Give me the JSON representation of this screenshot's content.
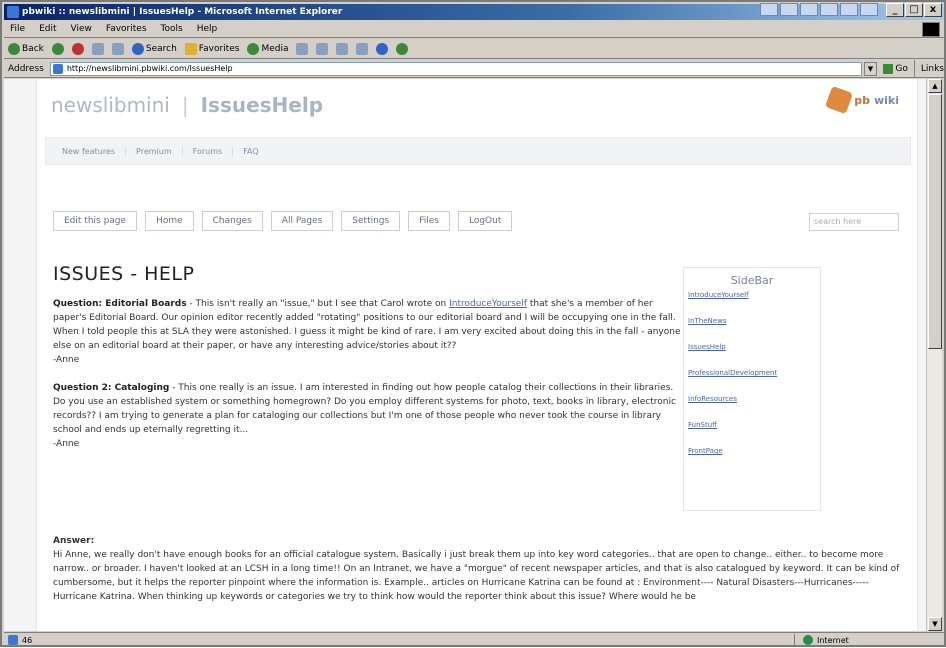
{
  "window": {
    "title": "pbwiki :: newslibmini | IssuesHelp - Microsoft Internet Explorer",
    "controls": {
      "minimize": "_",
      "maximize": "□",
      "close": "x"
    }
  },
  "menu": [
    "File",
    "Edit",
    "View",
    "Favorites",
    "Tools",
    "Help"
  ],
  "toolbar": {
    "back": "Back",
    "search": "Search",
    "favorites": "Favorites",
    "media": "Media"
  },
  "address": {
    "label": "Address",
    "url": "http://newslibmini.pbwiki.com/IssuesHelp",
    "go": "Go",
    "links": "Links"
  },
  "status": {
    "text": "46",
    "zone": "Internet"
  },
  "site": {
    "wiki_name": "newslibmini",
    "page_name": "IssuesHelp",
    "logo_pb": "pb",
    "logo_wiki": "wiki"
  },
  "subnav": [
    "New features",
    "Premium",
    "Forums",
    "FAQ"
  ],
  "actions": [
    "Edit this page",
    "Home",
    "Changes",
    "All Pages",
    "Settings",
    "Files",
    "LogOut"
  ],
  "search_placeholder": "search here",
  "page_title": "ISSUES - HELP",
  "q1": {
    "heading": "Question: Editorial Boards",
    "text_a": " - This isn't really an \"issue,\" but I see that Carol wrote on ",
    "link": "IntroduceYourself",
    "text_b": " that she's a member of her paper's Editorial Board. Our opinion editor recently added \"rotating\" positions to our editorial board and I will be occupying one in the fall. When I told people this at SLA they were astonished. I guess it might be kind of rare. I am very excited about doing this in the fall - anyone else on an editorial board at their paper, or have any interesting advice/stories about it??",
    "sign": "-Anne"
  },
  "q2": {
    "heading": "Question 2: Cataloging",
    "text": " - This one really is an issue. I am interested in finding out how people catalog their collections in their libraries. Do you use an established system or something homegrown? Do you employ different systems for photo, text, books in library, electronic records?? I am trying to generate a plan for cataloging our collections but I'm one of those people who never took the course in library school and ends up eternally regretting it...",
    "sign": "-Anne"
  },
  "answer": {
    "heading": "Answer:",
    "text": "Hi Anne, we really don't have enough books for an official catalogue system. Basically i just break them up into key word categories.. that are open to change.. either.. to become more narrow.. or broader. I haven't looked at an LCSH in a long time!! On an Intranet, we have a \"morgue\" of recent newspaper articles, and that is also catalogued by keyword. It can be kind of cumbersome, but it helps the reporter pinpoint where the information is. Example.. articles on Hurricane Katrina can be found at : Environment---- Natural Disasters---Hurricanes----- Hurricane Katrina. When thinking up keywords or categories we try to think how would the reporter think about this issue? Where would he be"
  },
  "sidebar": {
    "title": "SideBar",
    "links": [
      "IntroduceYourself",
      "InTheNews",
      "IssuesHelp",
      "ProfessionalDevelopment",
      "InfoResources",
      "FunStuff",
      "FrontPage"
    ]
  }
}
